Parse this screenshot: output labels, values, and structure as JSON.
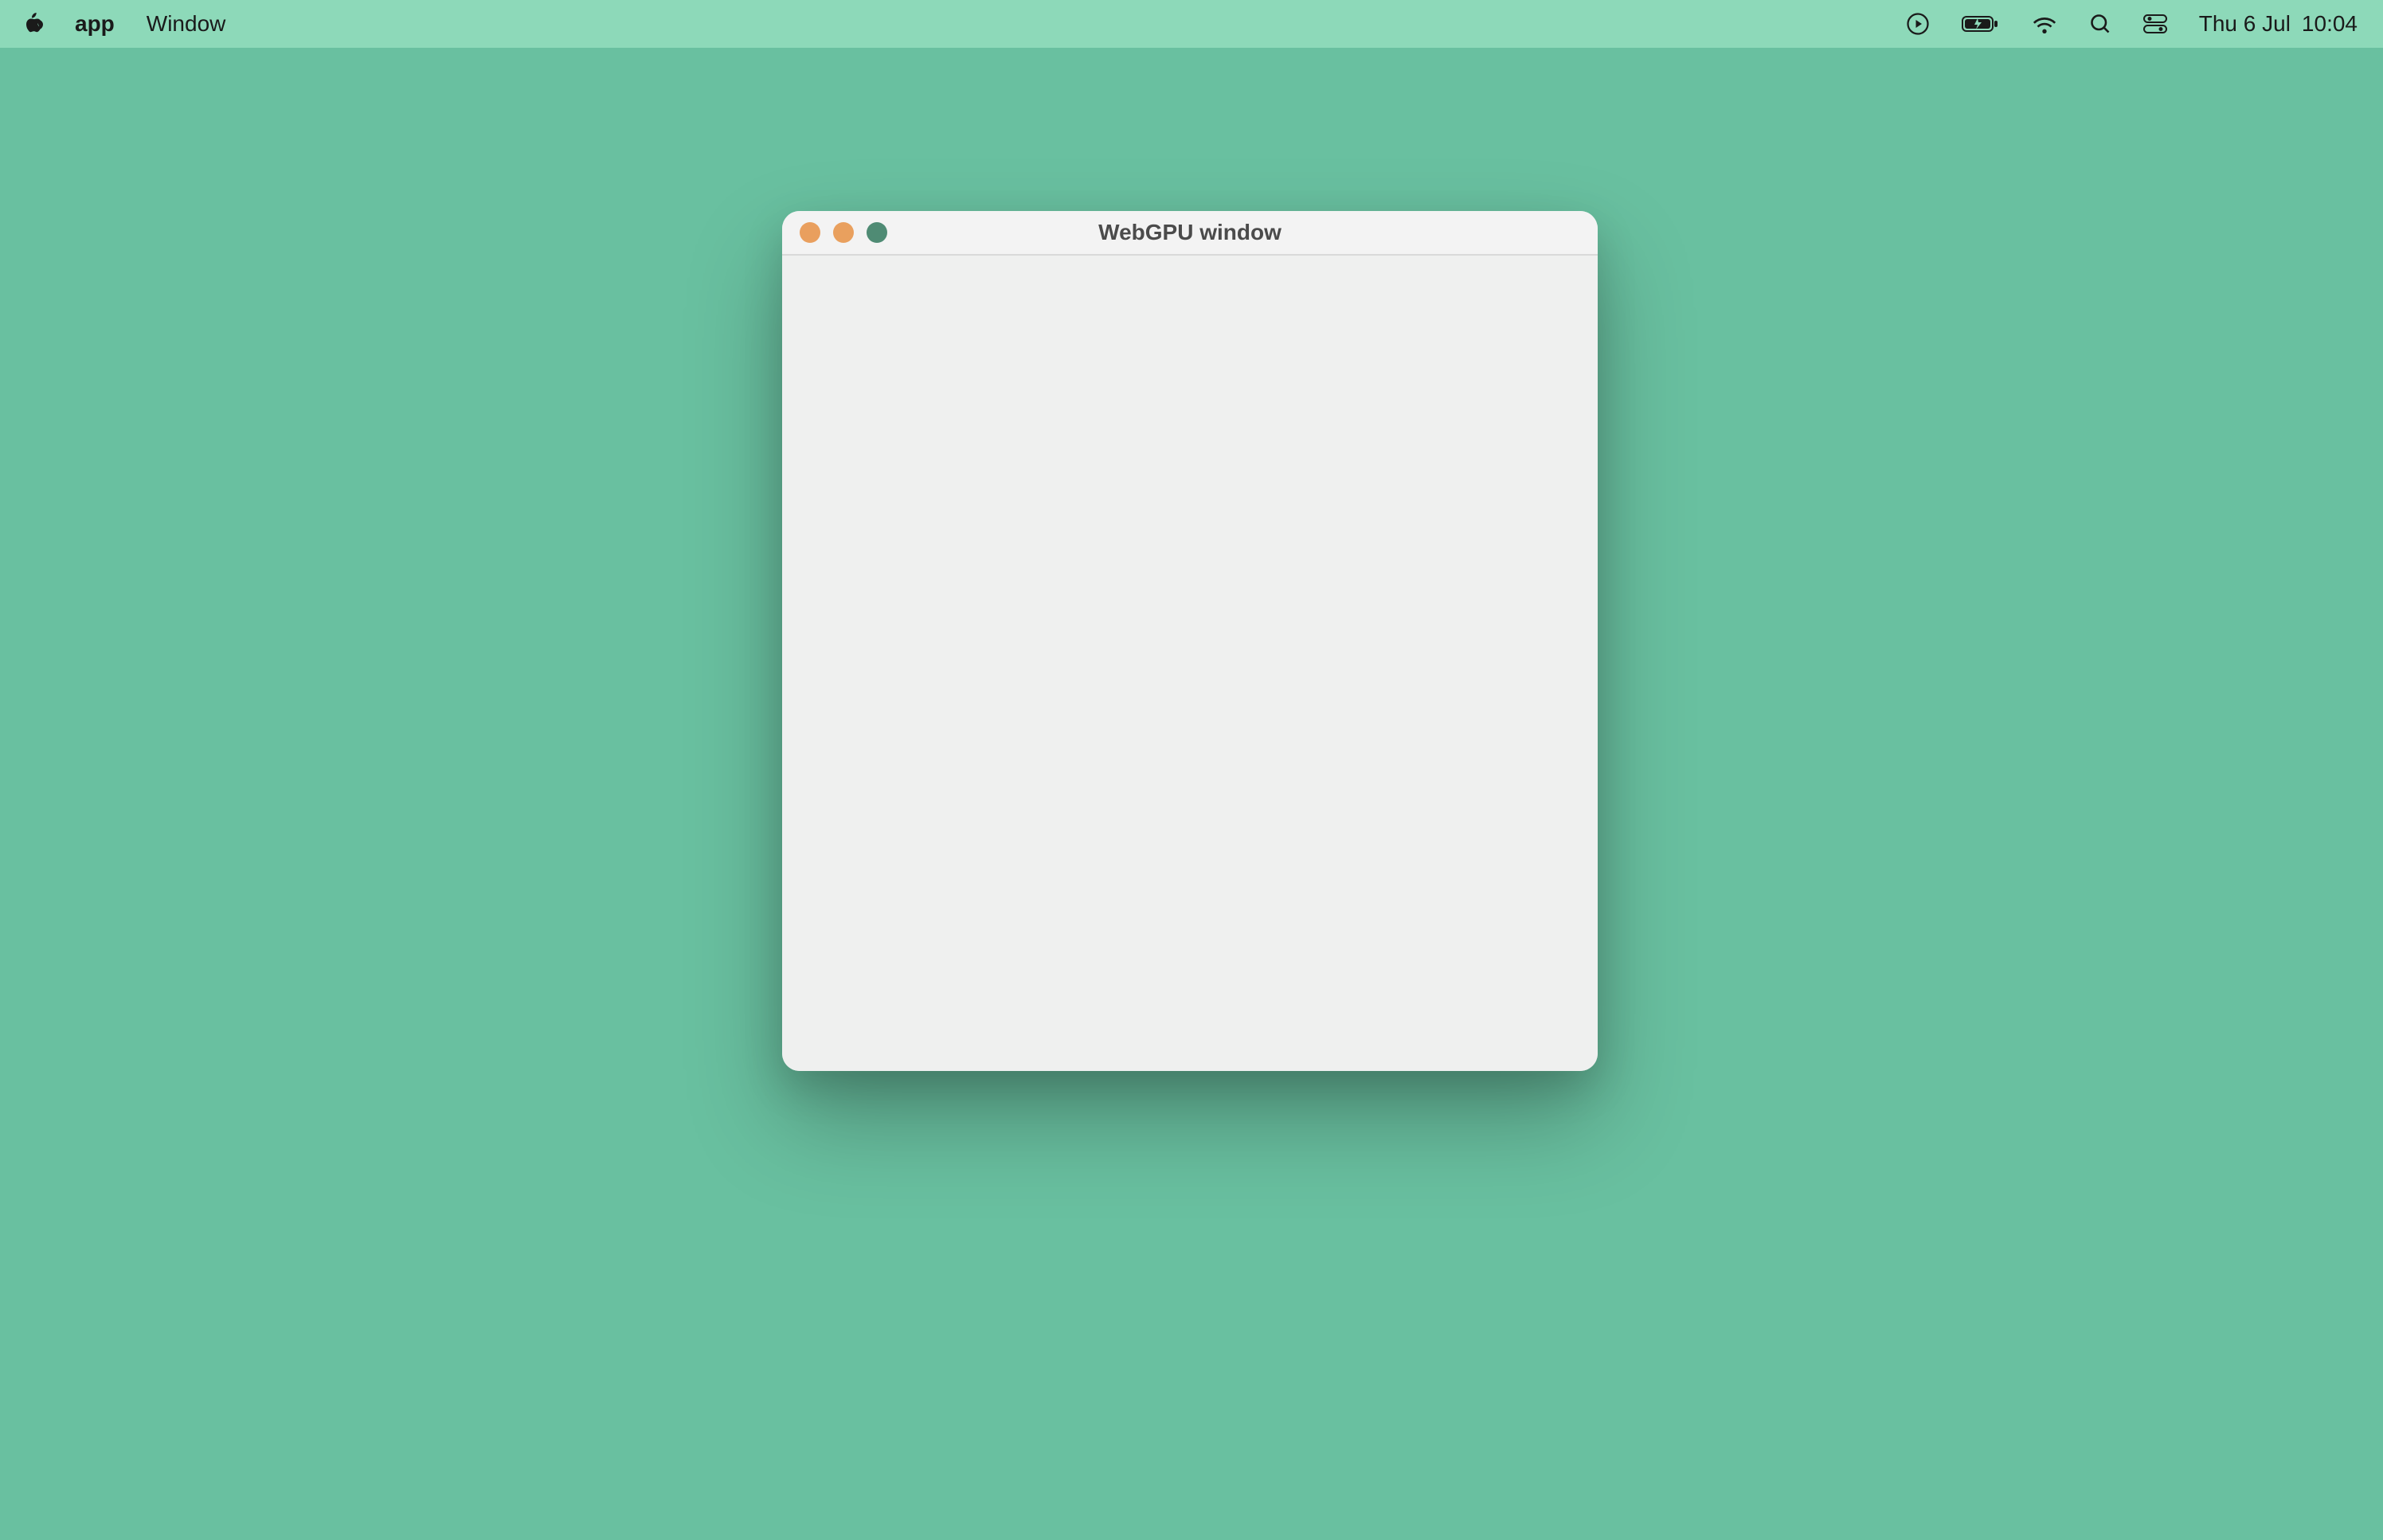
{
  "menubar": {
    "app_name": "app",
    "items": [
      "Window"
    ],
    "date": "Thu 6 Jul",
    "time": "10:04"
  },
  "window": {
    "title": "WebGPU window"
  },
  "icons": {
    "apple": "apple-icon",
    "playback": "playback-icon",
    "battery": "battery-icon",
    "wifi": "wifi-icon",
    "search": "search-icon",
    "control_center": "control-center-icon"
  },
  "colors": {
    "desktop": "#69c0a0",
    "menubar": "#8dd9b9",
    "window_bg": "#eff0ef",
    "traffic_close": "#e99f5e",
    "traffic_min": "#e9a05e",
    "traffic_zoom": "#4f8b74"
  }
}
